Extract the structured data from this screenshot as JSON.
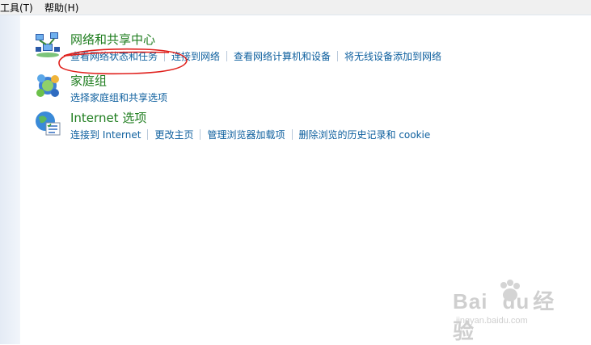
{
  "menubar": {
    "tools": "工具(T)",
    "help": "帮助(H)"
  },
  "categories": [
    {
      "title": "网络和共享中心",
      "icon": "network-sharing-icon",
      "links": [
        "查看网络状态和任务",
        "连接到网络",
        "查看网络计算机和设备",
        "将无线设备添加到网络"
      ]
    },
    {
      "title": "家庭组",
      "icon": "homegroup-icon",
      "links": [
        "选择家庭组和共享选项"
      ]
    },
    {
      "title": "Internet 选项",
      "icon": "internet-options-icon",
      "links": [
        "连接到 Internet",
        "更改主页",
        "管理浏览器加载项",
        "删除浏览的历史记录和 cookie"
      ]
    }
  ],
  "annotation": {
    "color": "#e0201c"
  },
  "watermark": {
    "brand": "Bai",
    "brand2": "du",
    "product": "经验",
    "site": "jingyan.baidu.com"
  }
}
